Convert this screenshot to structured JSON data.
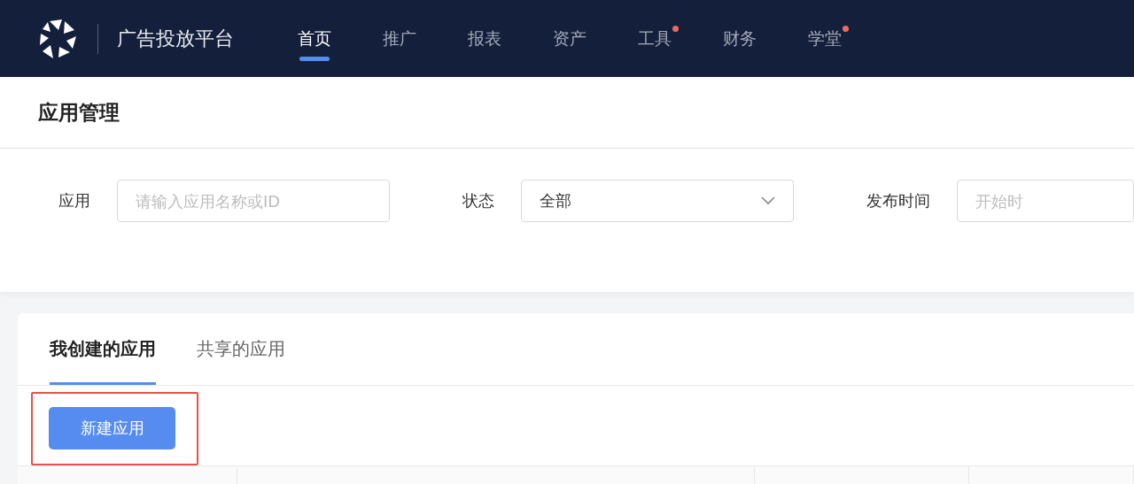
{
  "brand": {
    "title": "广告投放平台"
  },
  "nav": [
    {
      "label": "首页",
      "selected": true,
      "dot": false
    },
    {
      "label": "推广",
      "selected": false,
      "dot": false
    },
    {
      "label": "报表",
      "selected": false,
      "dot": false
    },
    {
      "label": "资产",
      "selected": false,
      "dot": false
    },
    {
      "label": "工具",
      "selected": false,
      "dot": true
    },
    {
      "label": "财务",
      "selected": false,
      "dot": false
    },
    {
      "label": "学堂",
      "selected": false,
      "dot": true
    }
  ],
  "page_title": "应用管理",
  "filters": [
    {
      "kind": "text",
      "label": "应用",
      "placeholder": "请输入应用名称或ID"
    },
    {
      "kind": "select",
      "label": "状态",
      "value": "全部"
    },
    {
      "kind": "date",
      "label": "发布时间",
      "placeholder": "开始时"
    }
  ],
  "tabs": [
    {
      "label": "我创建的应用",
      "selected": true
    },
    {
      "label": "共享的应用",
      "selected": false
    }
  ],
  "create_button": "新建应用"
}
